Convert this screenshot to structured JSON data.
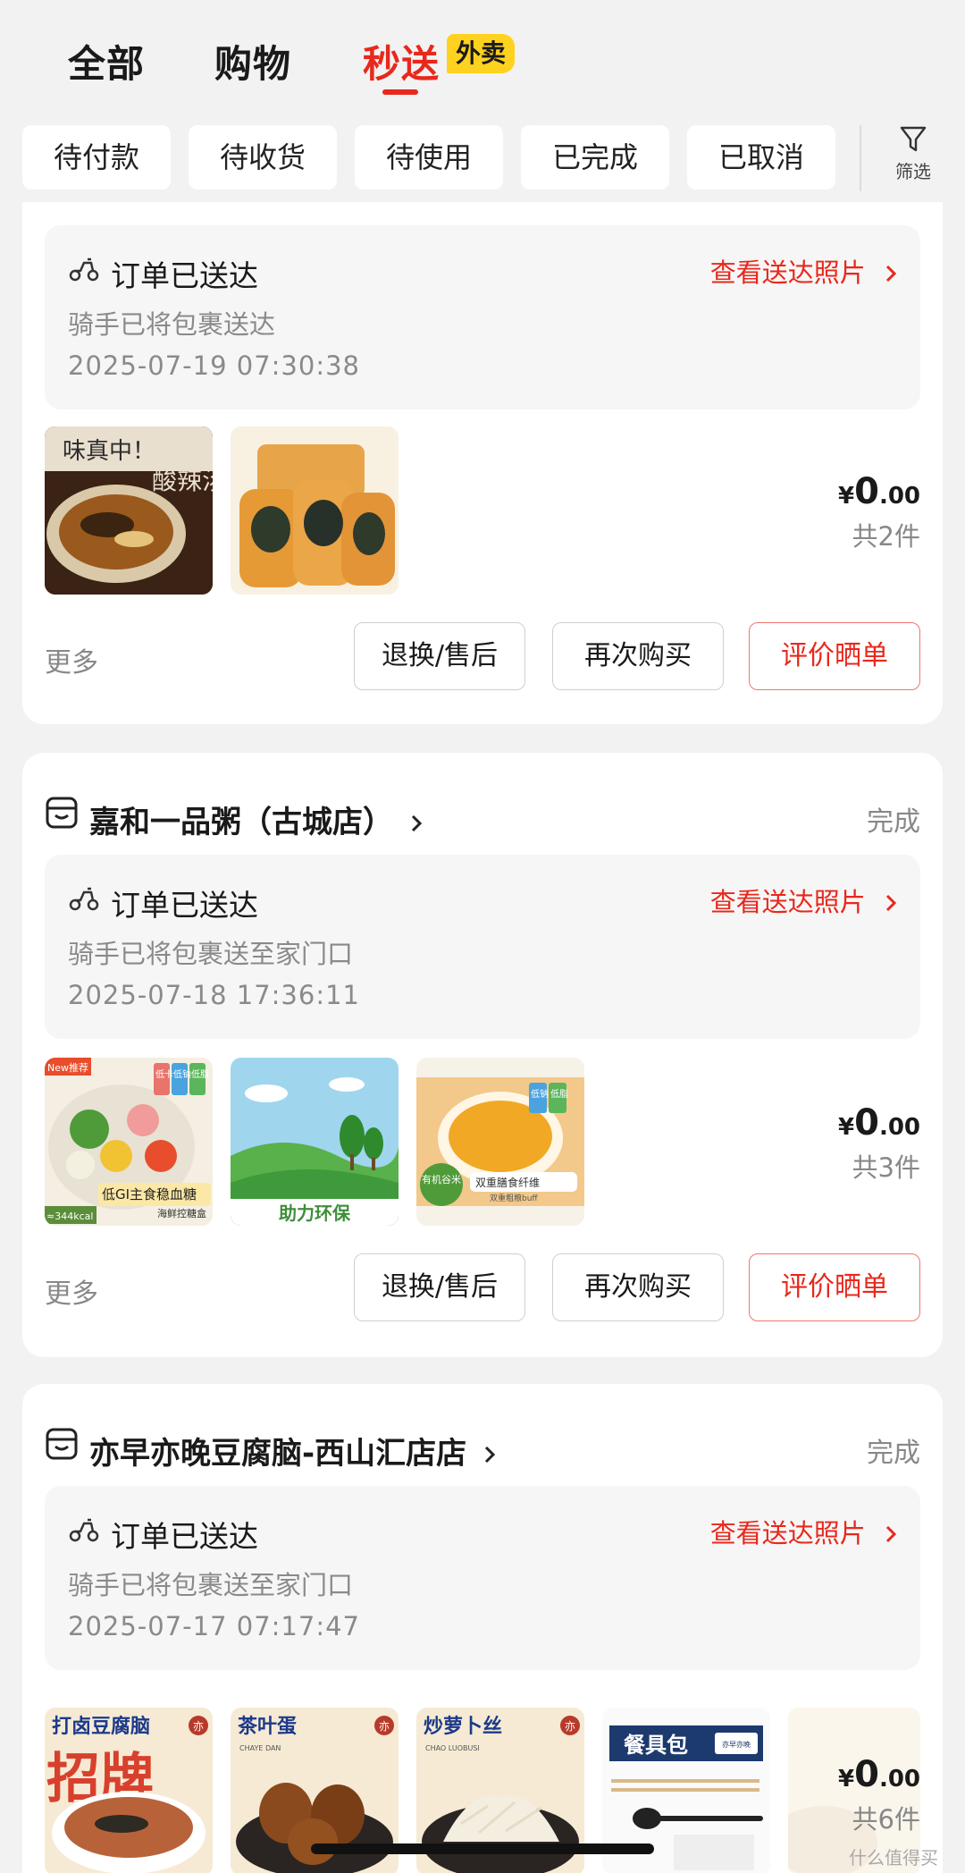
{
  "top_tabs": [
    {
      "label": "全部"
    },
    {
      "label": "购物"
    },
    {
      "label": "秒送",
      "badge": "外卖"
    }
  ],
  "filters": [
    "待付款",
    "待收货",
    "待使用",
    "已完成",
    "已取消"
  ],
  "filter_button": {
    "label": "筛选",
    "icon": "funnel-icon"
  },
  "orders": [
    {
      "delivery_title": "订单已送达",
      "delivery_sub": "骑手已将包裹送达",
      "delivery_time": "2025-07-19 07:30:38",
      "photo_link": "查看送达照片",
      "thumbs": [
        "酸辣汤",
        "海苔油条"
      ],
      "thumb_text": [
        "味真中！",
        "酸辣汤"
      ],
      "price_symbol": "¥",
      "price_int": "0",
      "price_dec": ".00",
      "count": "共2件",
      "more": "更多",
      "buttons": [
        "退换/售后",
        "再次购买",
        "评价晒单"
      ]
    },
    {
      "store": "嘉和一品粥（古城店）",
      "status": "完成",
      "delivery_title": "订单已送达",
      "delivery_sub": "骑手已将包裹送至家门口",
      "delivery_time": "2025-07-18 17:36:11",
      "photo_link": "查看送达照片",
      "thumb_text": [
        "New推荐",
        "低卡",
        "低钠",
        "低脂",
        "低GI主食稳血糖",
        "海鲜控糖盒",
        "≈344kcal",
        "助力环保",
        "有机谷米",
        "双重膳食纤维",
        "双重粗粮buff",
        "低钠",
        "低脂"
      ],
      "price_symbol": "¥",
      "price_int": "0",
      "price_dec": ".00",
      "count": "共3件",
      "more": "更多",
      "buttons": [
        "退换/售后",
        "再次购买",
        "评价晒单"
      ]
    },
    {
      "store": "亦早亦晚豆腐脑-西山汇店店",
      "status": "完成",
      "delivery_title": "订单已送达",
      "delivery_sub": "骑手已将包裹送至家门口",
      "delivery_time": "2025-07-17 07:17:47",
      "photo_link": "查看送达照片",
      "thumb_text": [
        "打卤豆腐脑",
        "招牌",
        "茶叶蛋",
        "CHAYE DAN",
        "炒萝卜丝",
        "CHAO LUOBUSI",
        "餐具包",
        "亦早亦晚",
        "亦"
      ],
      "price_symbol": "¥",
      "price_int": "0",
      "price_dec": ".00",
      "count": "共6件"
    }
  ],
  "watermark": "什么值得买",
  "colors": {
    "accent": "#e8281c",
    "badge": "#ffd21f",
    "background": "#f2f2f2"
  }
}
